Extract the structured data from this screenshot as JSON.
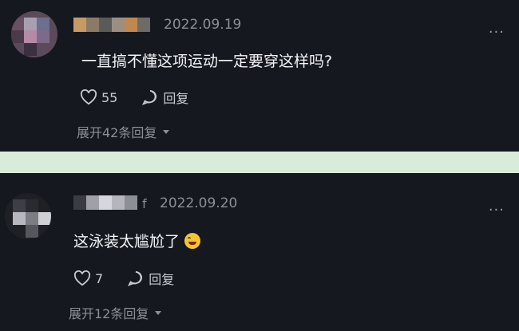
{
  "comments": [
    {
      "date": "2022.09.19",
      "text": "一直搞不懂这项运动一定要穿这样吗?",
      "like_count": "55",
      "reply_label": "回复",
      "expand_label": "展开42条回复",
      "more": "···"
    },
    {
      "name_suffix": "f",
      "date": "2022.09.20",
      "text": "这泳装太尴尬了",
      "like_count": "7",
      "reply_label": "回复",
      "expand_label": "展开12条回复",
      "more": "···"
    }
  ],
  "colors": {
    "background": "#16181f",
    "divider": "#d9ebd9"
  }
}
